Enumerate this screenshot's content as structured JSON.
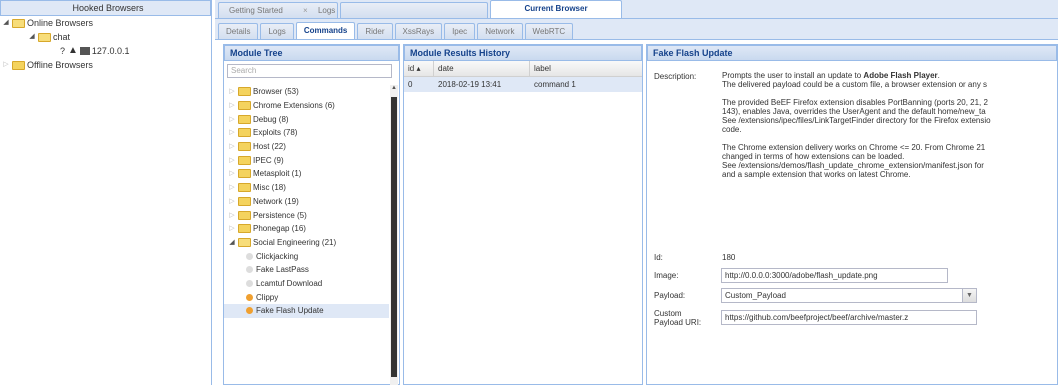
{
  "left": {
    "title": "Hooked Browsers",
    "online": "Online Browsers",
    "host": "chat",
    "ip_prefix": "?",
    "ip": "127.0.0.1",
    "offline": "Offline Browsers"
  },
  "tabs": {
    "getting_started": "Getting Started",
    "logs": "Logs",
    "current_browser": "Current Browser"
  },
  "subtabs": [
    "Details",
    "Logs",
    "Commands",
    "Rider",
    "XssRays",
    "Ipec",
    "Network",
    "WebRTC"
  ],
  "module_tree": {
    "title": "Module Tree",
    "search_placeholder": "Search",
    "items": [
      "Browser (53)",
      "Chrome Extensions (6)",
      "Debug (8)",
      "Exploits (78)",
      "Host (22)",
      "IPEC (9)",
      "Metasploit (1)",
      "Misc (18)",
      "Network (19)",
      "Persistence (5)",
      "Phonegap (16)",
      "Social Engineering (21)"
    ],
    "children": [
      "Clickjacking",
      "Fake LastPass",
      "Lcamtuf Download",
      "Clippy",
      "Fake Flash Update"
    ]
  },
  "results": {
    "title": "Module Results History",
    "columns": [
      "id",
      "date",
      "label"
    ],
    "rows": [
      [
        "0",
        "2018-02-19 13:41",
        "command 1"
      ]
    ]
  },
  "details": {
    "title": "Fake Flash Update",
    "description_label": "Description:",
    "desc1a": "Prompts the user to install an update to ",
    "desc1b": "Adobe Flash Player",
    "desc1c": ".",
    "desc2": "The delivered payload could be a custom file, a browser extension or any s",
    "desc3": "The provided BeEF Firefox extension disables PortBanning (ports 20, 21, 2",
    "desc4": "143), enables Java, overrides the UserAgent and the default home/new_ta",
    "desc5": "See /extensions/ipec/files/LinkTargetFinder directory for the Firefox extensio",
    "desc6": "code.",
    "desc7": "The Chrome extension delivery works on Chrome <= 20. From Chrome 21",
    "desc8": "changed in terms of how extensions can be loaded.",
    "desc9": "See /extensions/demos/flash_update_chrome_extension/manifest.json for",
    "desc10": "and a sample extension that works on latest Chrome.",
    "id_label": "Id:",
    "id_value": "180",
    "image_label": "Image:",
    "image_value": "http://0.0.0.0:3000/adobe/flash_update.png",
    "payload_label": "Payload:",
    "payload_value": "Custom_Payload",
    "custom_label_1": "Custom",
    "custom_label_2": "Payload URI:",
    "custom_value": "https://github.com/beefproject/beef/archive/master.z"
  }
}
